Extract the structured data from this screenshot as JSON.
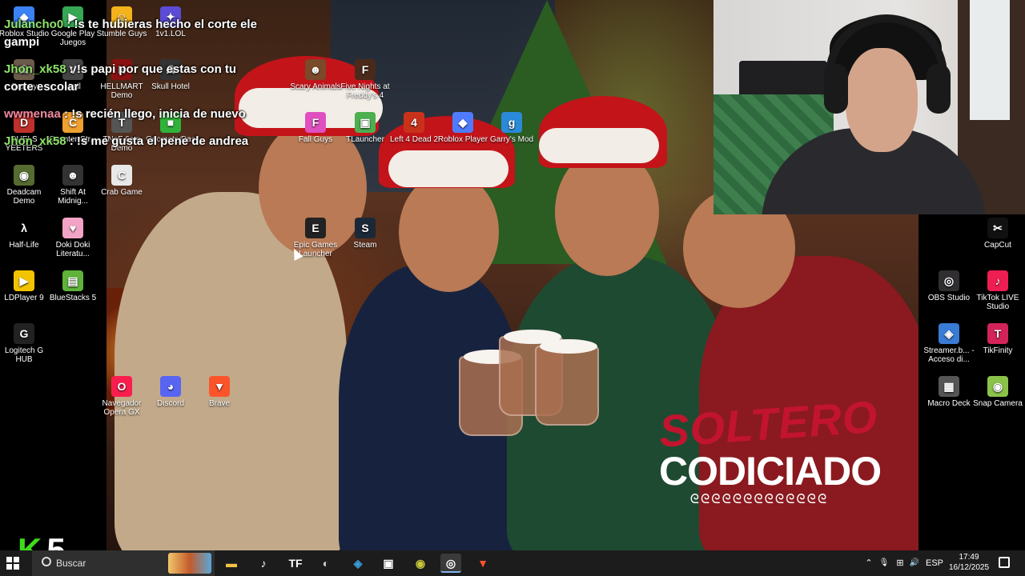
{
  "desktop_icons": [
    {
      "label": "Roblox Studio",
      "icon": "roblox-studio-icon",
      "color": "#3b82f6",
      "glyph": "◆"
    },
    {
      "label": "Google Play Juegos",
      "icon": "google-play-icon",
      "color": "#34a853",
      "glyph": "▶"
    },
    {
      "label": "Stumble Guys",
      "icon": "stumble-guys-icon",
      "color": "#f5b31b",
      "glyph": "☺"
    },
    {
      "label": "1v1.LOL",
      "icon": "1v1lol-icon",
      "color": "#5b4bd6",
      "glyph": "✦"
    },
    {
      "label": "Granny",
      "icon": "granny-icon",
      "color": "#6b5b4b",
      "glyph": "☠"
    },
    {
      "label": "Vrail",
      "icon": "vrail-icon",
      "color": "#444",
      "glyph": "V"
    },
    {
      "label": "HELLMART Demo",
      "icon": "hellmart-icon",
      "color": "#8a1111",
      "glyph": "H"
    },
    {
      "label": "Skull Hotel",
      "icon": "skull-hotel-icon",
      "color": "#333",
      "glyph": "☠"
    },
    {
      "label": "Scary Animals",
      "icon": "scary-animals-icon",
      "color": "#7a4a2a",
      "glyph": "☻"
    },
    {
      "label": "Five Nights at Freddy's 4",
      "icon": "fnaf4-icon",
      "color": "#4a2a1a",
      "glyph": "F"
    },
    {
      "label": "DUELS YEETERS",
      "icon": "duels-yeeters-icon",
      "color": "#c0302a",
      "glyph": "D"
    },
    {
      "label": "Counter-Str...",
      "icon": "counter-strike-icon",
      "color": "#f0a030",
      "glyph": "C"
    },
    {
      "label": "TNaF 6am Demo",
      "icon": "tnaf-icon",
      "color": "#555",
      "glyph": "T"
    },
    {
      "label": "GeometryDas",
      "icon": "geometry-dash-icon",
      "color": "#2fb33a",
      "glyph": "■"
    },
    {
      "label": "Fall Guys",
      "icon": "fall-guys-icon",
      "color": "#e04fc0",
      "glyph": "F"
    },
    {
      "label": "TLauncher",
      "icon": "tlauncher-icon",
      "color": "#4caf50",
      "glyph": "▣"
    },
    {
      "label": "Left 4 Dead 2",
      "icon": "left4dead2-icon",
      "color": "#c9321a",
      "glyph": "4"
    },
    {
      "label": "Roblox Player",
      "icon": "roblox-player-icon",
      "color": "#4f7cff",
      "glyph": "◆"
    },
    {
      "label": "Garry's Mod",
      "icon": "garrys-mod-icon",
      "color": "#2a8ad8",
      "glyph": "g"
    },
    {
      "label": "Deadcam Demo",
      "icon": "deadcam-icon",
      "color": "#556b2f",
      "glyph": "◉"
    },
    {
      "label": "Shift At Midnig...",
      "icon": "shift-at-midnight-icon",
      "color": "#333",
      "glyph": "☻"
    },
    {
      "label": "Crab Game",
      "icon": "crab-game-icon",
      "color": "#e8e8e8",
      "glyph": "C"
    },
    {
      "label": "Half-Life",
      "icon": "half-life-icon",
      "color": "#000",
      "glyph": "λ"
    },
    {
      "label": "Doki Doki Literatu...",
      "icon": "doki-doki-icon",
      "color": "#f3a3c6",
      "glyph": "♥"
    },
    {
      "label": "Epic Games Launcher",
      "icon": "epic-games-icon",
      "color": "#222",
      "glyph": "E"
    },
    {
      "label": "Steam",
      "icon": "steam-icon",
      "color": "#1b2838",
      "glyph": "S"
    },
    {
      "label": "LDPlayer 9",
      "icon": "ldplayer-icon",
      "color": "#f2c400",
      "glyph": "▶"
    },
    {
      "label": "BlueStacks 5",
      "icon": "bluestacks-icon",
      "color": "#5fb33a",
      "glyph": "▤"
    },
    {
      "label": "Logitech G HUB",
      "icon": "logitech-ghub-icon",
      "color": "#222",
      "glyph": "G"
    },
    {
      "label": "Navegador Opera GX",
      "icon": "opera-gx-icon",
      "color": "#fa1e4e",
      "glyph": "O"
    },
    {
      "label": "Discord",
      "icon": "discord-icon",
      "color": "#5865f2",
      "glyph": "◕"
    },
    {
      "label": "Brave",
      "icon": "brave-icon",
      "color": "#fb542b",
      "glyph": "▼"
    },
    {
      "label": "CapCut",
      "icon": "capcut-icon",
      "color": "#111",
      "glyph": "✂"
    },
    {
      "label": "OBS Studio",
      "icon": "obs-studio-icon",
      "color": "#302e31",
      "glyph": "◎"
    },
    {
      "label": "TikTok LIVE Studio",
      "icon": "tiktok-live-icon",
      "color": "#ee1d52",
      "glyph": "♪"
    },
    {
      "label": "Streamer.b... - Acceso di...",
      "icon": "streamer-bot-icon",
      "color": "#3a7bd5",
      "glyph": "◈"
    },
    {
      "label": "TikFinity",
      "icon": "tikfinity-icon",
      "color": "#d3245a",
      "glyph": "T"
    },
    {
      "label": "Macro Deck",
      "icon": "macro-deck-icon",
      "color": "#555",
      "glyph": "▦"
    },
    {
      "label": "Snap Camera",
      "icon": "snap-camera-icon",
      "color": "#8bc34a",
      "glyph": "◉"
    }
  ],
  "chat": [
    {
      "user": "Julancho0",
      "sep": " : ",
      "text": "!s te hubieras hecho el corte ele gampi",
      "user_color": "#8fe36a"
    },
    {
      "user": "Jhon_xk58",
      "sep": " : ",
      "text": "!s papi por que estas con tu corte escolar",
      "user_color": "#8fe36a"
    },
    {
      "user": "wwmenaa",
      "sep": " : ",
      "text": "!s recién llego, inicia de nuevo",
      "user_color": "#f08aa0"
    },
    {
      "user": "Jhon_xk58",
      "sep": " : ",
      "text": "!s me gusta el pene de andrea",
      "user_color": "#8fe36a"
    }
  ],
  "wallpaper": {
    "title_line1": "SOLTERO",
    "title_line2": "CODICIADO",
    "swirl": "ᘓᘓᘓᘓᘓᘓᘓᘓᘓᘓᘓᘓᘓ"
  },
  "overlay": {
    "logo_k": "K",
    "logo_n": "5"
  },
  "taskbar": {
    "search_placeholder": "Buscar",
    "apps": [
      {
        "name": "file-explorer-icon",
        "glyph": "▬",
        "color": "#f3c343"
      },
      {
        "name": "tiktok-icon",
        "glyph": "♪",
        "color": "#ffffff"
      },
      {
        "name": "tikfinity-icon",
        "glyph": "TF",
        "color": "#ffffff"
      },
      {
        "name": "app-shield-icon",
        "glyph": "◐",
        "color": "#d0d0d0"
      },
      {
        "name": "streamerbot-icon",
        "glyph": "◈",
        "color": "#3a9bd5"
      },
      {
        "name": "app-window-icon",
        "glyph": "▣",
        "color": "#ffffff"
      },
      {
        "name": "snap-camera-icon",
        "glyph": "◉",
        "color": "#c8c83a"
      },
      {
        "name": "obs-icon",
        "glyph": "◎",
        "color": "#ffffff"
      },
      {
        "name": "brave-icon",
        "glyph": "▼",
        "color": "#fb542b"
      }
    ],
    "tray": {
      "chevron": "⌃",
      "mic": "🎙",
      "network": "⊞",
      "volume": "🔊",
      "language": "ESP",
      "time": "17:49",
      "date": "16/12/2025"
    }
  }
}
